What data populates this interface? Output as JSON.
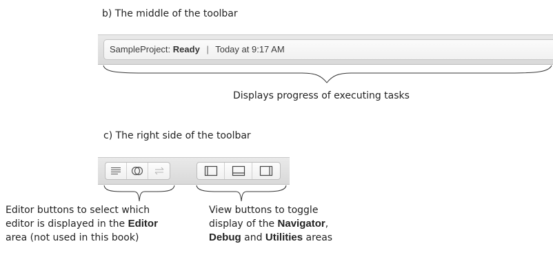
{
  "captions": {
    "middle": "b) The middle of the toolbar",
    "right": "c) The right side of the toolbar"
  },
  "activity": {
    "project": "SampleProject:",
    "status": "Ready",
    "separator": "|",
    "time": "Today at 9:17 AM"
  },
  "labels": {
    "progress": "Displays progress of executing tasks",
    "editor_line1": "Editor buttons to select which",
    "editor_line2a": "editor is displayed in the ",
    "editor_line2b": "Editor",
    "editor_line3": "area (not used in this book)",
    "view_line1": "View buttons to toggle",
    "view_line2a": "display of the ",
    "view_line2b": "Navigator",
    "view_line2c": ",",
    "view_line3a": "Debug",
    "view_line3b": " and ",
    "view_line3c": "Utilities",
    "view_line3d": " areas"
  },
  "icons": {
    "editor": [
      "standard-editor-icon",
      "assistant-editor-icon",
      "version-editor-icon"
    ],
    "view": [
      "navigator-toggle-icon",
      "debug-toggle-icon",
      "utilities-toggle-icon"
    ]
  }
}
